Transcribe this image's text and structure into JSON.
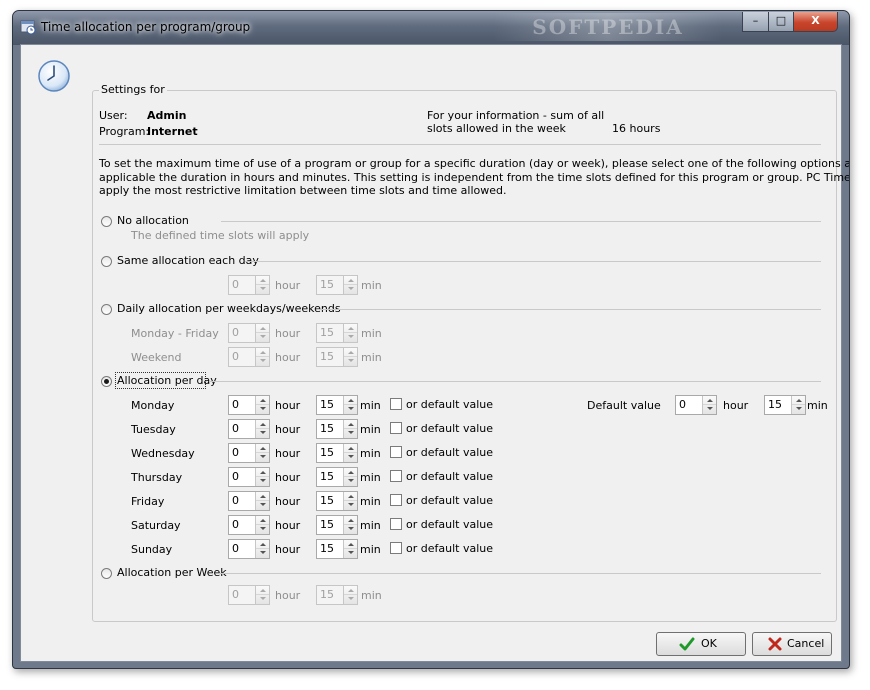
{
  "window": {
    "title": "Time allocation per program/group",
    "banner": "SOFTPEDIA",
    "minimize_glyph": "–",
    "maximize_glyph": "□",
    "close_glyph": "X"
  },
  "icons": {
    "app": "clock-icon",
    "ok": "checkmark-icon",
    "cancel": "x-mark-icon"
  },
  "colors": {
    "ok_check": "#1f9a2a",
    "cancel_x": "#c0281c",
    "title_gradient_top": "#8f9aab",
    "title_gradient_bottom": "#4a5567"
  },
  "settings": {
    "group_label": "Settings for",
    "user_label": "User:",
    "user_value": "Admin",
    "program_label": "Program:",
    "program_value": "Internet",
    "info_line1": "For your information - sum of all",
    "info_line2": "slots allowed in the week",
    "info_value": "16 hours"
  },
  "description": [
    "To set the maximum time of use of a program or group for a specific duration (day or week), please select one of the following options and set if",
    "applicable the duration in hours and minutes. This setting is independent from the time slots defined for this program or group. PC TimeWatch will",
    "apply the most restrictive limitation between time slots and time allowed."
  ],
  "units": {
    "hour": "hour",
    "min": "min"
  },
  "options": {
    "no_allocation": {
      "label": "No allocation",
      "note": "The defined time slots will apply"
    },
    "same_each_day": {
      "label": "Same allocation each day",
      "hour": "0",
      "min": "15"
    },
    "weekdays_weekends": {
      "label": "Daily allocation per weekdays/weekends",
      "weekday_label": "Monday - Friday",
      "weekday_hour": "0",
      "weekday_min": "15",
      "weekend_label": "Weekend",
      "weekend_hour": "0",
      "weekend_min": "15"
    },
    "per_day": {
      "label": "Allocation per day",
      "selected": true,
      "default_label": "Default value",
      "default_hour": "0",
      "default_min": "15",
      "or_default": "or default value",
      "days": [
        {
          "name": "Monday",
          "hour": "0",
          "min": "15"
        },
        {
          "name": "Tuesday",
          "hour": "0",
          "min": "15"
        },
        {
          "name": "Wednesday",
          "hour": "0",
          "min": "15"
        },
        {
          "name": "Thursday",
          "hour": "0",
          "min": "15"
        },
        {
          "name": "Friday",
          "hour": "0",
          "min": "15"
        },
        {
          "name": "Saturday",
          "hour": "0",
          "min": "15"
        },
        {
          "name": "Sunday",
          "hour": "0",
          "min": "15"
        }
      ]
    },
    "per_week": {
      "label": "Allocation per Week",
      "hour": "0",
      "min": "15"
    }
  },
  "buttons": {
    "ok": "OK",
    "cancel": "Cancel"
  }
}
